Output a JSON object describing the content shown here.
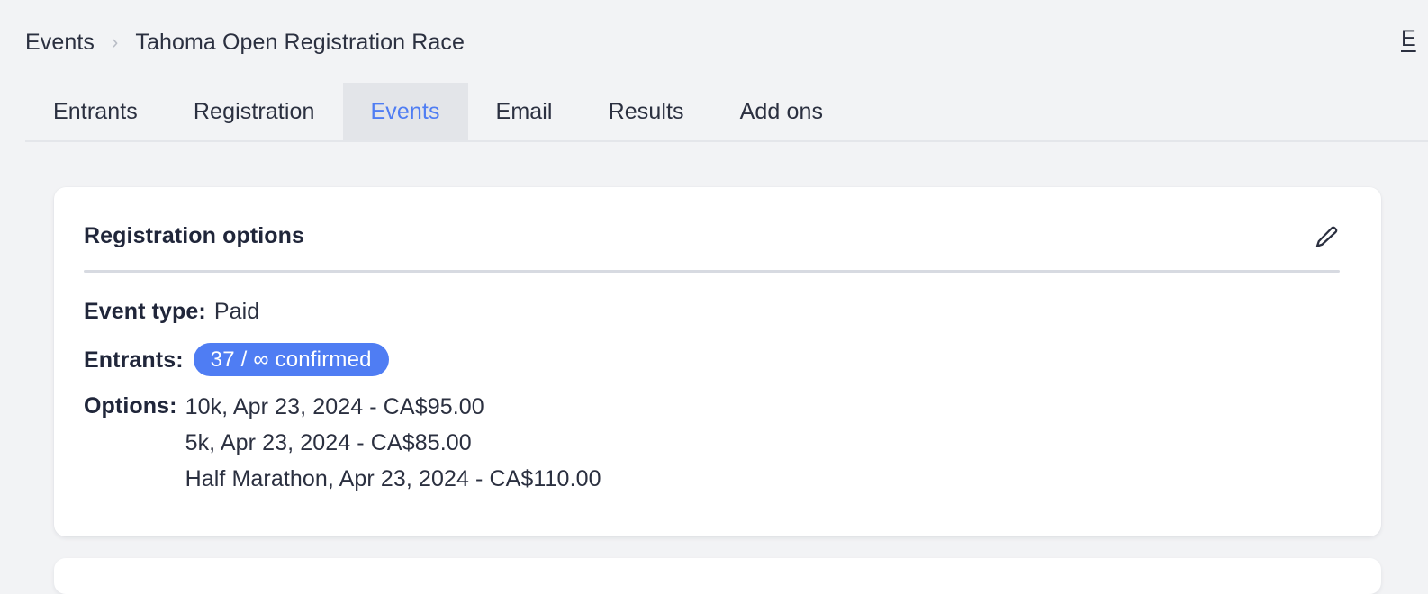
{
  "breadcrumb": {
    "root_label": "Events",
    "separator": "›",
    "current_label": "Tahoma Open Registration Race"
  },
  "header": {
    "top_right_link": "E"
  },
  "tabs": [
    {
      "label": "Entrants",
      "active": false
    },
    {
      "label": "Registration",
      "active": false
    },
    {
      "label": "Events",
      "active": true
    },
    {
      "label": "Email",
      "active": false
    },
    {
      "label": "Results",
      "active": false
    },
    {
      "label": "Add ons",
      "active": false
    }
  ],
  "card": {
    "title": "Registration options",
    "edit_icon": "pencil-icon",
    "event_type": {
      "label": "Event type:",
      "value": "Paid"
    },
    "entrants": {
      "label": "Entrants:",
      "badge_text": "37 / ∞ confirmed",
      "badge_color": "#4f7df3",
      "confirmed_count": 37,
      "capacity": "∞"
    },
    "options": {
      "label": "Options:",
      "items": [
        "10k, Apr 23, 2024 - CA$95.00",
        "5k, Apr 23, 2024 - CA$85.00",
        "Half Marathon, Apr 23, 2024 - CA$110.00"
      ]
    }
  },
  "colors": {
    "page_background": "#f2f3f5",
    "card_background": "#ffffff",
    "accent_blue": "#4f7df3",
    "active_tab_background": "#e3e5e9",
    "text_primary": "#2b3040",
    "divider": "#d7dae1"
  }
}
